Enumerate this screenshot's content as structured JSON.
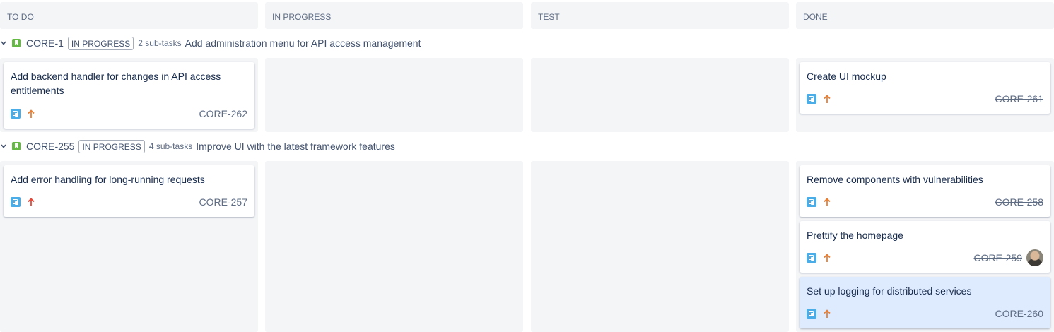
{
  "columns": [
    {
      "label": "TO DO"
    },
    {
      "label": "IN PROGRESS"
    },
    {
      "label": "TEST"
    },
    {
      "label": "DONE"
    }
  ],
  "swimlanes": [
    {
      "key": "CORE-1",
      "status": "IN PROGRESS",
      "subtasks": "2 sub-tasks",
      "summary": "Add administration menu for API access management",
      "cards": {
        "todo": [
          {
            "summary": "Add backend handler for changes in API access entitlements",
            "key": "CORE-262",
            "priority": "medium",
            "priority_color": "#e97f33"
          }
        ],
        "done": [
          {
            "summary": "Create UI mockup",
            "key": "CORE-261",
            "priority": "medium",
            "priority_color": "#e97f33"
          }
        ]
      }
    },
    {
      "key": "CORE-255",
      "status": "IN PROGRESS",
      "subtasks": "4 sub-tasks",
      "summary": "Improve UI with the latest framework features",
      "cards": {
        "todo": [
          {
            "summary": "Add error handling for long-running requests",
            "key": "CORE-257",
            "priority": "high",
            "priority_color": "#e5493a"
          }
        ],
        "done": [
          {
            "summary": "Remove components with vulnerabilities",
            "key": "CORE-258",
            "priority": "medium",
            "priority_color": "#e97f33"
          },
          {
            "summary": "Prettify the homepage",
            "key": "CORE-259",
            "priority": "medium",
            "priority_color": "#e97f33",
            "assignee": "avatar"
          },
          {
            "summary": "Set up logging for distributed services",
            "key": "CORE-260",
            "priority": "medium",
            "priority_color": "#e97f33",
            "selected": true
          }
        ]
      }
    }
  ],
  "icons": {
    "story": "story-icon",
    "subtask": "subtask-icon",
    "priority": "arrow-up-icon",
    "collapse": "chevron-down-icon"
  },
  "colors": {
    "story": "#65ba43",
    "subtask": "#4bade8",
    "column_bg": "#f4f5f7",
    "selected_card": "#deebff"
  }
}
